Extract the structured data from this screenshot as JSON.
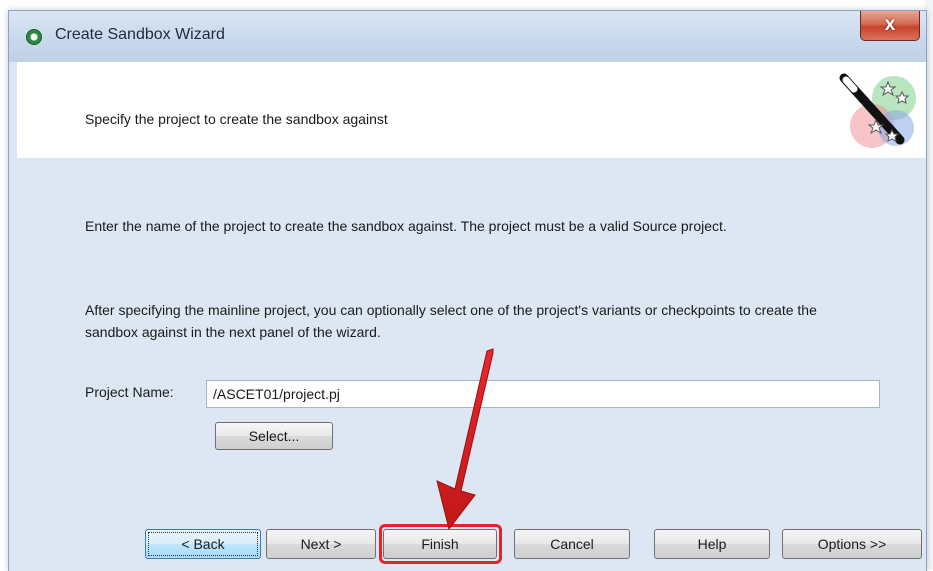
{
  "window": {
    "title": "Create Sandbox Wizard",
    "close_label": "X"
  },
  "header": {
    "text": "Specify the project to create the sandbox against"
  },
  "content": {
    "paragraph1": "Enter the name of the project to create the sandbox against.  The project must be a valid Source project.",
    "paragraph2": "After specifying the mainline project, you can optionally select one of the project's variants or checkpoints to create the sandbox against in the next panel of the wizard.",
    "project_name_label": "Project Name:",
    "project_name_value": "/ASCET01/project.pj",
    "select_button": "Select..."
  },
  "buttons": {
    "back": "< Back",
    "next": "Next >",
    "finish": "Finish",
    "cancel": "Cancel",
    "help": "Help",
    "options": "Options >>"
  },
  "annotation": {
    "highlight_color": "#e0242a",
    "target": "finish"
  }
}
